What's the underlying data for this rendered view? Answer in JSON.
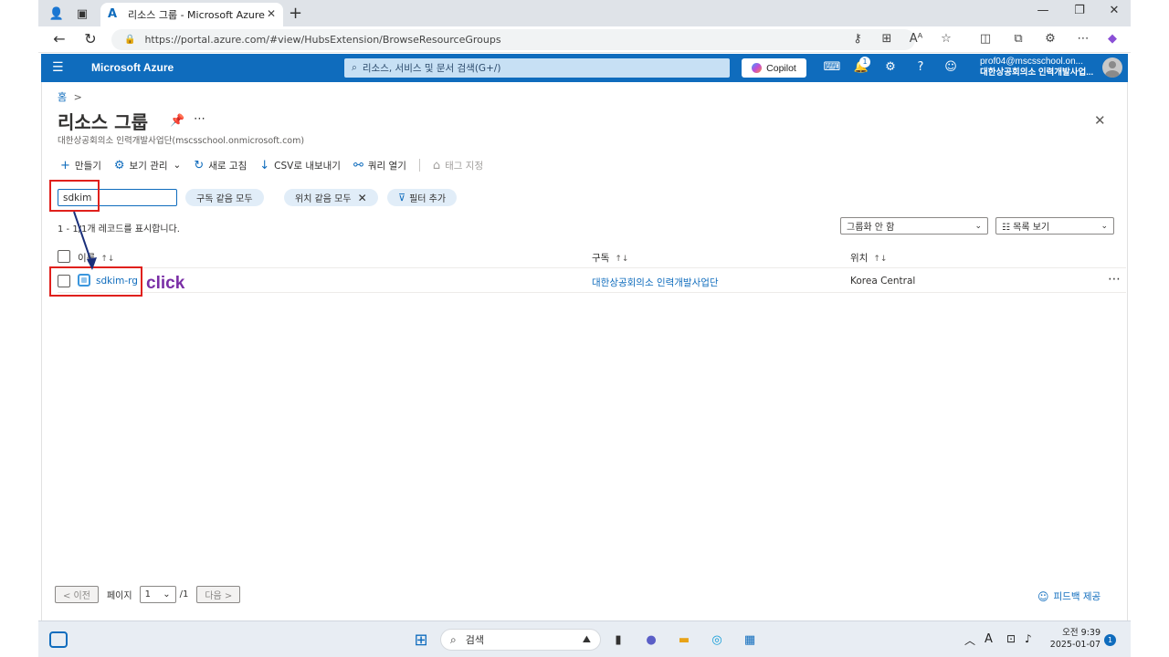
{
  "browser": {
    "tab_title": "리소스 그룹 - Microsoft Azure",
    "url": "https://portal.azure.com/#view/HubsExtension/BrowseResourceGroups"
  },
  "header": {
    "brand": "Microsoft Azure",
    "search_placeholder": "리소스, 서비스 및 문서 검색(G+/)",
    "copilot_label": "Copilot",
    "notification_count": "1",
    "user_email": "prof04@mscsschool.on...",
    "user_org": "대한상공회의소 인력개발사업..."
  },
  "page": {
    "breadcrumb_home": "홈",
    "breadcrumb_sep": ">",
    "title": "리소스 그룹",
    "subtitle": "대한상공회의소 인력개발사업단(mscsschool.onmicrosoft.com)"
  },
  "commands": {
    "create": "만들기",
    "manage_view": "보기 관리",
    "refresh": "새로 고침",
    "export_csv": "CSV로 내보내기",
    "open_query": "쿼리 열기",
    "assign_tags": "태그 지정"
  },
  "filters": {
    "search_value": "sdkim",
    "subscription_pill": "구독 같음 모두",
    "location_pill": "위치 같음 모두",
    "add_filter": "필터 추가"
  },
  "list": {
    "record_count": "1 - 1/1개 레코드를 표시합니다.",
    "grouping": "그룹화 안 함",
    "view_mode": "목록 보기",
    "columns": [
      "이름",
      "구독",
      "위치"
    ],
    "rows": [
      {
        "name": "sdkim-rg",
        "subscription": "대한상공회의소 인력개발사업단",
        "location": "Korea Central"
      }
    ]
  },
  "annotation": {
    "label": "click",
    "color": "#e0201c",
    "text_color": "#7a2fa6"
  },
  "pager": {
    "prev": "< 이전",
    "page_label": "페이지",
    "page_value": "1",
    "page_total": "/1",
    "next": "다음 >"
  },
  "feedback": "피드백 제공",
  "taskbar": {
    "search": "검색",
    "time": "오전 9:39",
    "date": "2025-01-07",
    "ime": "A",
    "notifications": "1"
  },
  "colors": {
    "azure_blue": "#0f6cbd",
    "search_bg": "#c7e0f4",
    "pill_bg": "#e1edf8"
  }
}
